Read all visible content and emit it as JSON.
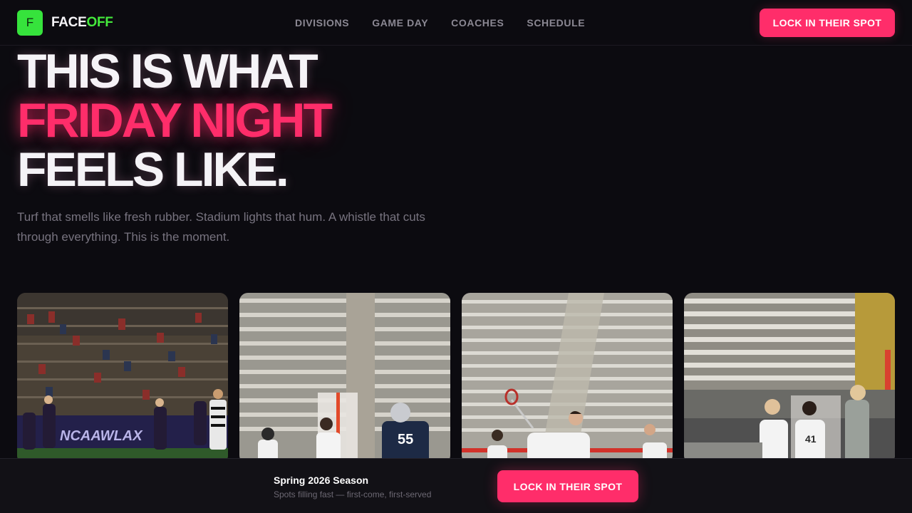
{
  "brand": {
    "logo_letter": "F",
    "name_part1": "FACE",
    "name_part2": "OFF",
    "logo_color": "#36e33c",
    "accent_color": "#ff2d6a"
  },
  "nav": {
    "links": [
      "DIVISIONS",
      "GAME DAY",
      "COACHES",
      "SCHEDULE"
    ],
    "cta_label": "LOCK IN THEIR SPOT"
  },
  "hero": {
    "line1": "THIS IS WHAT",
    "line2": "FRIDAY NIGHT",
    "line3": "FEELS LIKE.",
    "subtitle": "Turf that smells like fresh rubber. Stadium lights that hum. A whistle that cuts through everything. This is the moment."
  },
  "photos": {
    "photo2_jersey": "55",
    "photo4_jersey": "41"
  },
  "bottom_bar": {
    "title": "Spring 2026 Season",
    "note": "Spots filling fast — first-come, first-served",
    "cta_label": "LOCK IN THEIR SPOT"
  }
}
